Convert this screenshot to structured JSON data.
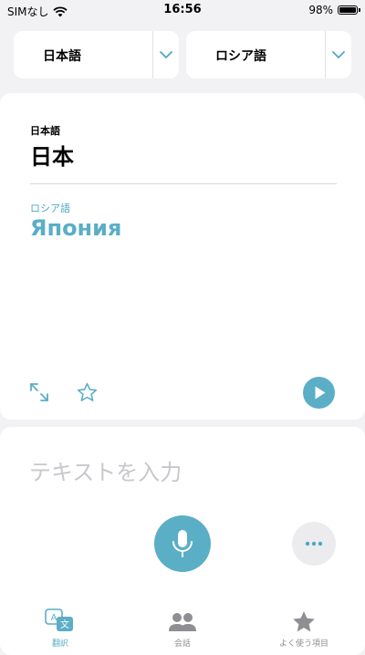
{
  "status_bar": {
    "carrier": "SIMなし",
    "time": "16:56",
    "battery": "98%",
    "battery_level": 0.98
  },
  "source_language_selector": {
    "label": "日本語"
  },
  "target_language_selector": {
    "label": "ロシア語"
  },
  "translation": {
    "source_language": "日本語",
    "source_text": "日本",
    "target_language": "ロシア語",
    "target_text": "Япония"
  },
  "input": {
    "placeholder": "テキストを入力"
  },
  "tabs": [
    {
      "label": "翻訳",
      "icon": "translate-icon",
      "active": true
    },
    {
      "label": "会話",
      "icon": "conversation-icon",
      "active": false
    },
    {
      "label": "よく使う項目",
      "icon": "star-icon",
      "active": false
    }
  ],
  "colors": {
    "accent": "#5aaec6",
    "background": "#f2f2f5",
    "card": "#ffffff",
    "inactive": "#8e8e93"
  }
}
